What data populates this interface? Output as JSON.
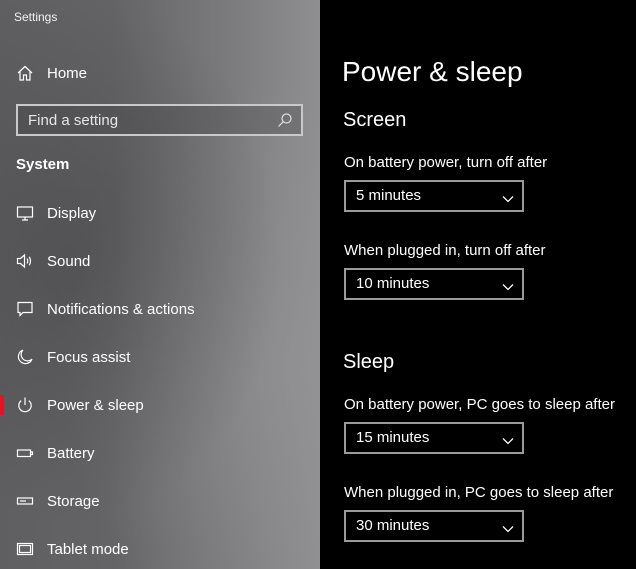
{
  "app": {
    "title": "Settings"
  },
  "nav": {
    "home_label": "Home",
    "search_placeholder": "Find a setting",
    "section_label": "System",
    "items": [
      {
        "label": "Display",
        "icon": "display-icon"
      },
      {
        "label": "Sound",
        "icon": "speaker-icon"
      },
      {
        "label": "Notifications & actions",
        "icon": "notifications-icon"
      },
      {
        "label": "Focus assist",
        "icon": "moon-icon"
      },
      {
        "label": "Power & sleep",
        "icon": "power-icon",
        "selected": true
      },
      {
        "label": "Battery",
        "icon": "battery-icon"
      },
      {
        "label": "Storage",
        "icon": "storage-icon"
      },
      {
        "label": "Tablet mode",
        "icon": "tablet-icon"
      }
    ],
    "accent_color": "#e81123"
  },
  "main": {
    "title": "Power & sleep",
    "screen": {
      "heading": "Screen",
      "battery_label": "On battery power, turn off after",
      "battery_value": "5 minutes",
      "plugged_label": "When plugged in, turn off after",
      "plugged_value": "10 minutes"
    },
    "sleep": {
      "heading": "Sleep",
      "battery_label": "On battery power, PC goes to sleep after",
      "battery_value": "15 minutes",
      "plugged_label": "When plugged in, PC goes to sleep after",
      "plugged_value": "30 minutes"
    }
  }
}
